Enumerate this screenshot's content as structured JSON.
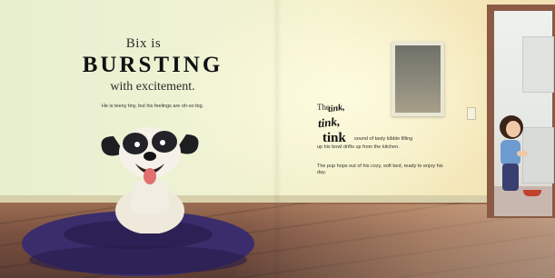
{
  "left_page": {
    "headline_line1": "Bix is",
    "headline_line2": "BURSTING",
    "headline_line3": "with excitement.",
    "subtext": "He is teeny tiny, but his feelings are oh-so big."
  },
  "right_page": {
    "sfx_the": "The",
    "sfx_tink1": "tink,",
    "sfx_tink2": "tink,",
    "sfx_tink3": "tink",
    "paragraph1_start": "sound of tasty kibble filling",
    "paragraph1_end": "up his bowl drifts up from the kitchen.",
    "paragraph2": "The pup hops out of his cozy, soft bed, ready to enjoy his day."
  },
  "colors": {
    "wall": "#eef2d3",
    "floor": "#7b5241",
    "rug": "#3b2d6b",
    "door_frame": "#8a5a45",
    "bowl": "#c2422e"
  }
}
